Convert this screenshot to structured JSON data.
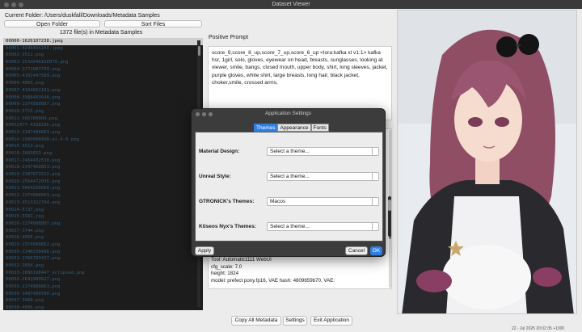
{
  "window": {
    "title": "Dataset Viewer"
  },
  "folder": {
    "label": "Current Folder: /Users/duskfall/Downloads/Metadata Samples",
    "open_button": "Open Folder",
    "sort_button": "Sort Files",
    "file_count": "1372 file(s) in Metadata Samples"
  },
  "files": [
    "00000-1626107238.jpeg",
    "00001-3246494280.jpeg",
    "00002-3511.png",
    "00003-2534946166070.png",
    "00004-2771097799.png",
    "00005-4102447589.png",
    "00006-4003.png",
    "00007-4164662101.png",
    "00008-3988403648.png",
    "00009-2374588087.png",
    "00010-5713.png",
    "00011-566780604.png",
    "00012477-4168206.png",
    "00013-2347488863.png",
    "00014-2999908498-ai-4-0.png",
    "00015-3513.png",
    "00016-1665653.png",
    "00017-2464432538.png",
    "00018-2347488863.png",
    "00019-2397872522.png",
    "00020-2564472036.png",
    "00021-5664256068.png",
    "00022-2374988863.png",
    "00023-3513322784.png",
    "00024-5737.png",
    "00025-5581.jpg",
    "00026-2374988807.png",
    "00027-3744.png",
    "00028-4056.png",
    "00029-2374988862.png",
    "00030-2346238488.png",
    "00031-2366783437.png",
    "00032-3034.png",
    "00033-2080198447_eclipsed.png",
    "00034-2641909627.png",
    "00035-2374988863.png",
    "00036-3497490780.png",
    "00037-3968.png",
    "00038-4006.png",
    "00039-3513.png",
    "00040-5511.png"
  ],
  "prompt": {
    "label": "Positive Prompt",
    "text": "score_9,score_8_up,score_7_up,score_6_up <lora:kafka xl v1:1> kafka hsr, 1girl, solo, gloves, eyewear on head, breasts, sunglasses, looking at viewer, smile, bangs, closed mouth, upper body, shirt, long sleeves, jacket, purple gloves, white shirt, large breasts, long hair, black jacket, choker,smile, crossed arms,"
  },
  "metadata_lines": [
    "Tool: Automatic1111 WebUI",
    "cfg_scale: 7.0",
    "height: 1824",
    "model: prefect pony.fp16, VAE hash: 4809659b70, VAE:"
  ],
  "bottom_buttons": {
    "copy": "Copy All Metadata",
    "settings": "Settings",
    "exit": "Exit Application"
  },
  "corner_text": "22 - Jul 2025 20:02:35 +1000",
  "dialog": {
    "title": "Application Settings",
    "tabs": [
      "Themes",
      "Appearance",
      "Fonts"
    ],
    "active_tab": "Themes",
    "rows": [
      {
        "label": "Material Design:",
        "value": "Select a theme..."
      },
      {
        "label": "Unreal Style:",
        "value": "Select a theme..."
      },
      {
        "label": "GTRONICK's Themes:",
        "value": "Macos"
      },
      {
        "label": "Ktiseos Nyx's Themes:",
        "value": "Select a theme..."
      }
    ],
    "apply": "Apply",
    "cancel": "Cancel",
    "ok": "OK"
  },
  "colors": {
    "accent": "#2f7fe2",
    "file_text": "#2b5e84",
    "list_bg": "#1c1c1c"
  },
  "icons": [
    "close-dot",
    "minimize-dot",
    "zoom-dot",
    "chevron-down-icon"
  ]
}
